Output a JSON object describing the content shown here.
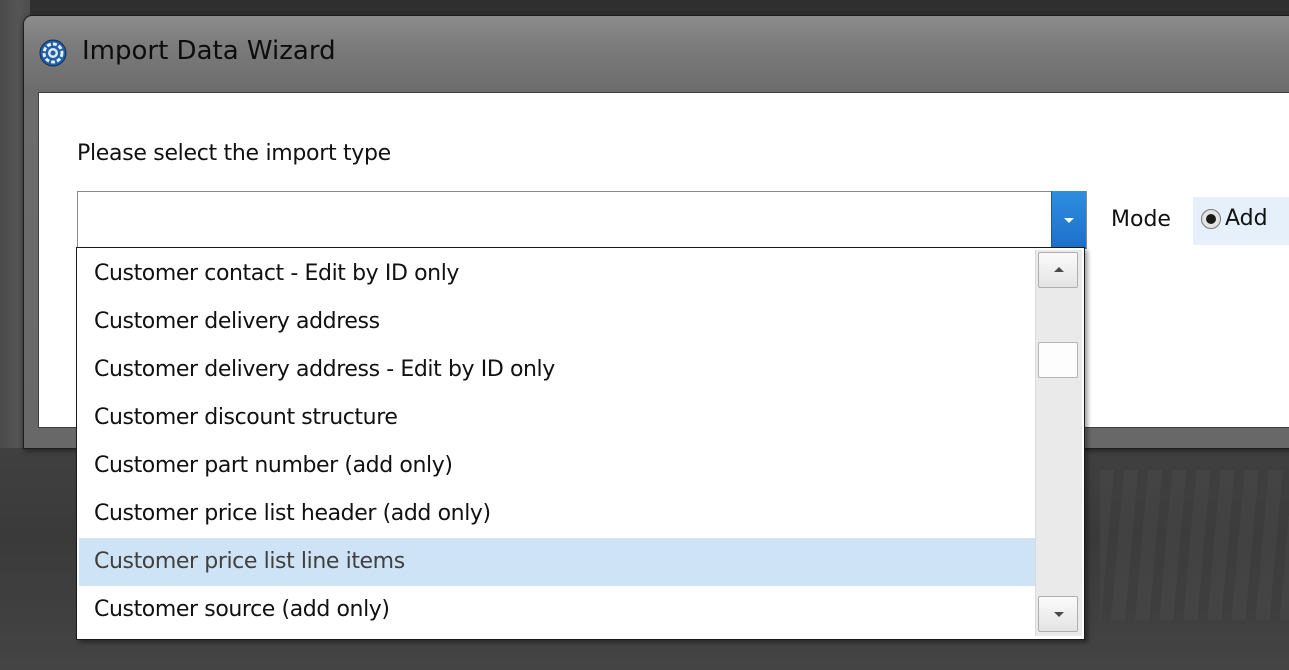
{
  "window": {
    "title": "Import Data Wizard",
    "icon": "gear-icon"
  },
  "wizard": {
    "prompt": "Please select the import type",
    "import_type_value": "",
    "mode_label": "Mode",
    "mode_options": [
      {
        "label": "Add",
        "checked": true
      }
    ]
  },
  "dropdown": {
    "items": [
      "Customer contact - Edit by ID only",
      "Customer delivery address",
      "Customer delivery address - Edit by ID only",
      "Customer discount structure",
      "Customer part number (add only)",
      "Customer price list header (add only)",
      "Customer price list line items",
      "Customer source (add only)"
    ],
    "highlighted_item": "Customer price list line items"
  },
  "colors": {
    "dropdown_button": "#2f8ee0",
    "highlight": "#cfe3f6",
    "window_frame": "#7b7b7b"
  }
}
